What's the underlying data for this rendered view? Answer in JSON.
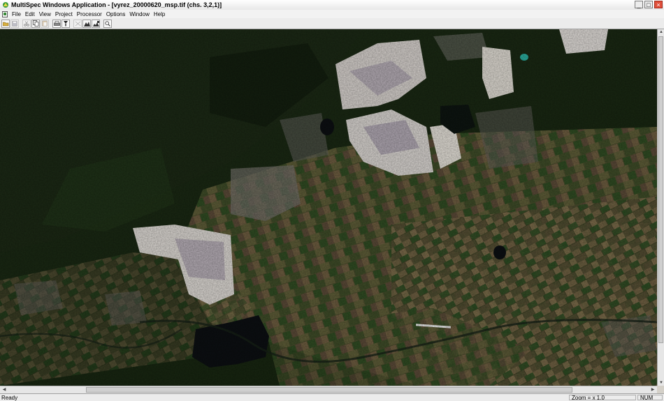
{
  "window": {
    "title": "MultiSpec Windows Application - [vyrez_20000620_msp.tif (chs. 3,2,1)]",
    "buttons": {
      "minimize": "_",
      "restore": "□",
      "close": "×"
    }
  },
  "menubar": {
    "items": [
      "File",
      "Edit",
      "View",
      "Project",
      "Processor",
      "Options",
      "Window",
      "Help"
    ]
  },
  "toolbar": {
    "icons": [
      "open-icon",
      "save-icon",
      "cut-icon",
      "copy-icon",
      "paste-icon",
      "print-icon",
      "info-icon",
      "zoom-out-icon",
      "histogram-icon",
      "histogram-overlay-icon",
      "zoom-tool-icon"
    ]
  },
  "status": {
    "ready": "Ready",
    "zoom": "Zoom = x 1.0",
    "num": "NUM"
  },
  "colors": {
    "forest": "#1f2a17",
    "mine": "#c9c5c0",
    "water": "#0c0f12",
    "close_button": "#e0503c"
  }
}
